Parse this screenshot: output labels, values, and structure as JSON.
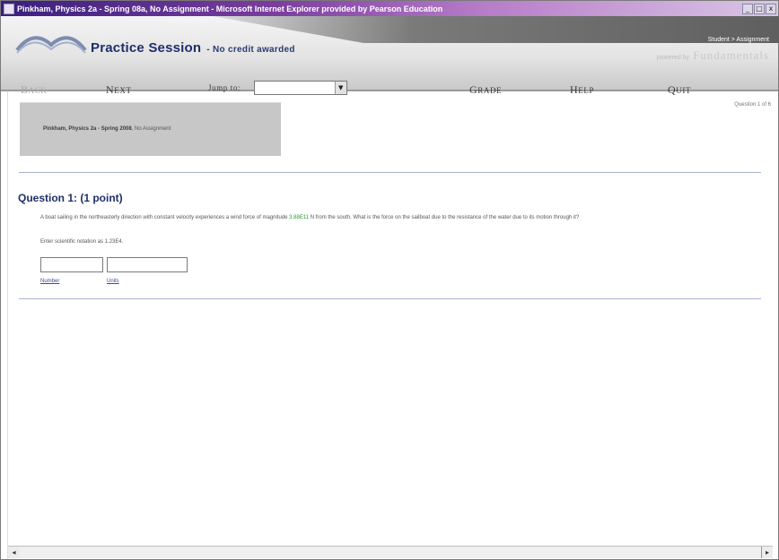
{
  "window": {
    "title": "Pinkham, Physics 2a - Spring 08a, No Assignment - Microsoft Internet Explorer provided by Pearson Education",
    "btn_min": "_",
    "btn_max": "□",
    "btn_close": "x"
  },
  "header": {
    "title": "Practice Session",
    "subtitle": "- No credit awarded",
    "top_links": "Student > Assignment",
    "brand_prefix": "powered by",
    "brand": "Fundamentals"
  },
  "nav": {
    "back_cap": "B",
    "back_label": "ACK",
    "next_cap": "N",
    "next_label": "EXT",
    "jump_label": "Jump to:",
    "jump_selected": "",
    "grade_cap": "G",
    "grade_label": "RADE",
    "help_cap": "H",
    "help_label": "ELP",
    "quit_cap": "Q",
    "quit_label": "UIT"
  },
  "info": {
    "course_bold": "Pinkham, Physics 2a - Spring 2008",
    "course_rest": ", No Assignment",
    "question_counter": "Question 1 of 6"
  },
  "question": {
    "heading": "Question 1: (1 point)",
    "body_pre": "A boat sailing in the northeasterly direction with constant velocity experiences a wind force of magnitude ",
    "force_value": "3.88E11",
    "body_post": " N from the south. What is the force on the sailboat due to the resistance of the water due to its motion through it?",
    "hint": "Enter scientific notation as 1.23E4.",
    "number_value": "",
    "units_value": "",
    "number_link": "Number",
    "units_link": "Units"
  },
  "scroll": {
    "left_arrow": "◂",
    "right_arrow": "▸"
  }
}
